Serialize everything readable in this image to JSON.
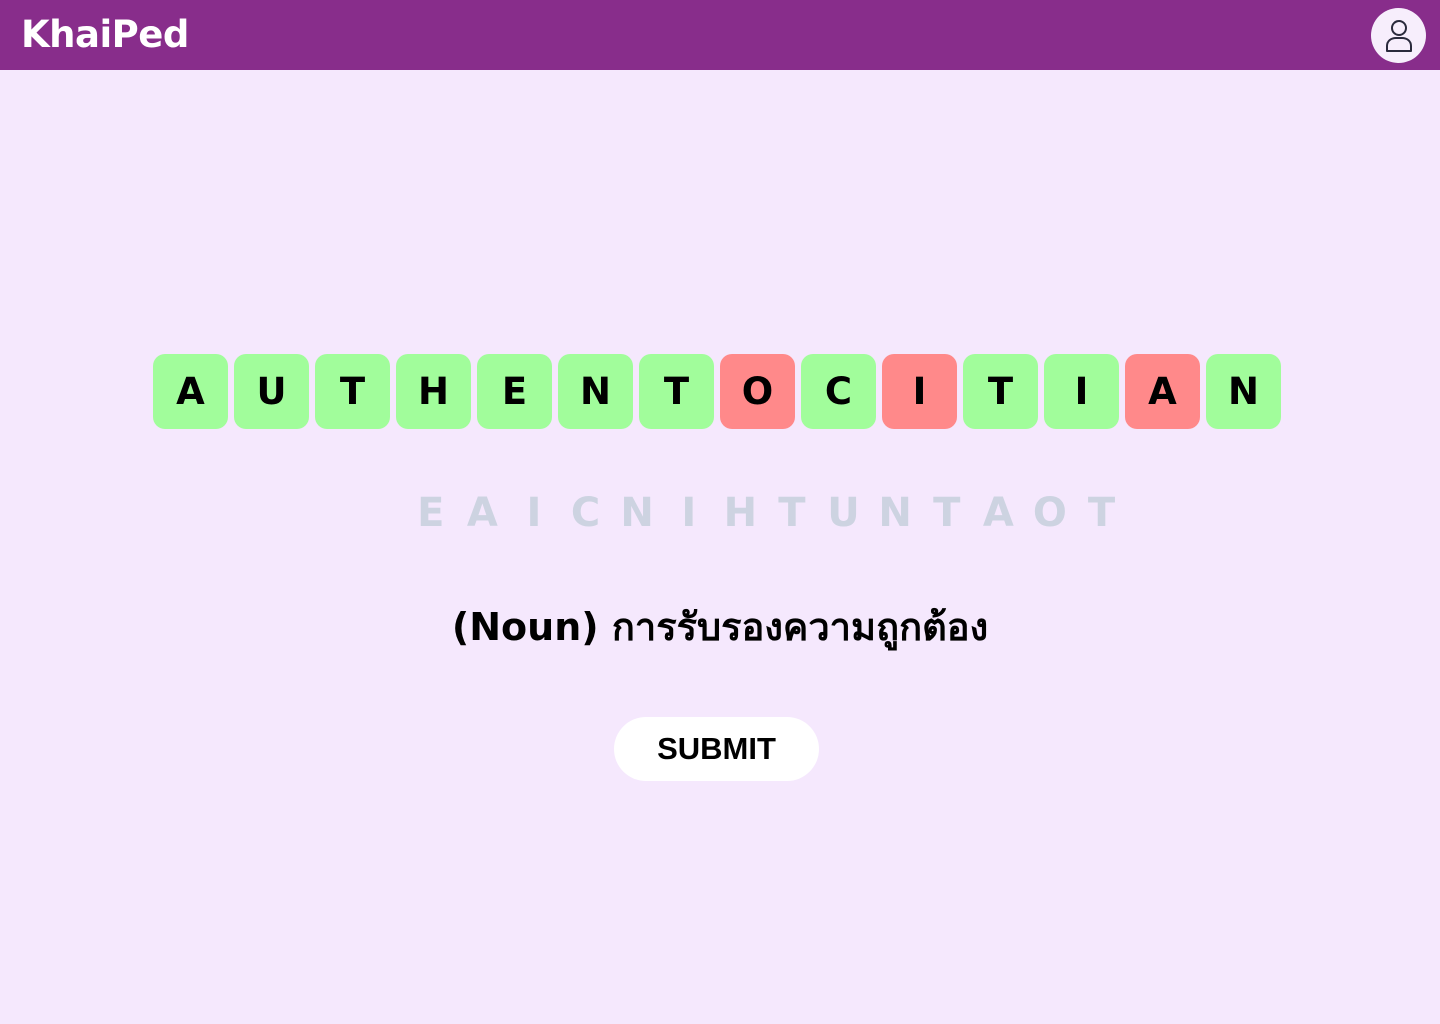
{
  "app": {
    "name": "KhaiPed",
    "header_color": "#882d8b",
    "background_color": "#f5e8fd"
  },
  "header": {
    "user_icon": "user-icon"
  },
  "answer_tiles": [
    {
      "letter": "A",
      "status": "correct"
    },
    {
      "letter": "U",
      "status": "correct"
    },
    {
      "letter": "T",
      "status": "correct"
    },
    {
      "letter": "H",
      "status": "correct"
    },
    {
      "letter": "E",
      "status": "correct"
    },
    {
      "letter": "N",
      "status": "correct"
    },
    {
      "letter": "T",
      "status": "correct"
    },
    {
      "letter": "O",
      "status": "wrong"
    },
    {
      "letter": "C",
      "status": "correct"
    },
    {
      "letter": "I",
      "status": "wrong"
    },
    {
      "letter": "T",
      "status": "correct"
    },
    {
      "letter": "I",
      "status": "correct"
    },
    {
      "letter": "A",
      "status": "wrong"
    },
    {
      "letter": "N",
      "status": "correct"
    }
  ],
  "status_colors": {
    "correct": "#a1fd9b",
    "wrong": "#ff898a",
    "scrambled_text": "#cdd3e1"
  },
  "scrambled_letters": [
    "E",
    "A",
    "I",
    "C",
    "N",
    "I",
    "H",
    "T",
    "U",
    "N",
    "T",
    "A",
    "O",
    "T"
  ],
  "definition": {
    "part_of_speech": "(Noun)",
    "meaning": "การรับรองความถูกต้อง"
  },
  "submit_label": "SUBMIT"
}
